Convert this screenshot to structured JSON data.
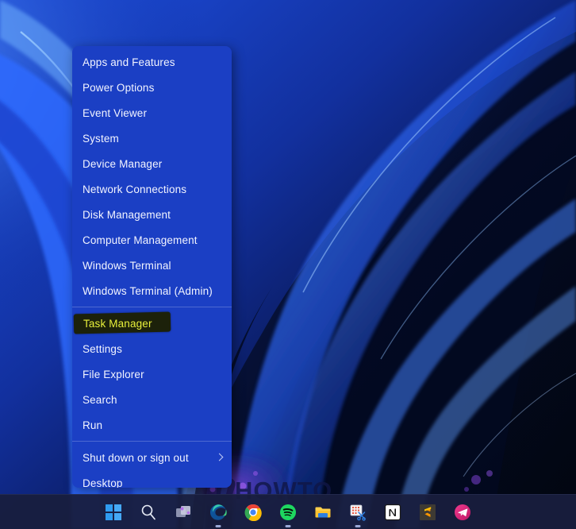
{
  "desktop": {
    "wallpaper_name": "windows-11-bloom-blue",
    "colors": {
      "bg_deep": "#09133a",
      "ribbon_bright": "#2f6cff",
      "ribbon_mid": "#1535b4",
      "ribbon_dark": "#050b26",
      "accent": "#3a7bff"
    }
  },
  "watermark": {
    "text": "HOWTO",
    "color": "#101646"
  },
  "winx_menu": {
    "name": "Windows X / Quick Link menu",
    "background": "#1b3fc4",
    "items": [
      {
        "label": "Apps and Features",
        "type": "item",
        "chevron": false
      },
      {
        "label": "Power Options",
        "type": "item",
        "chevron": false
      },
      {
        "label": "Event Viewer",
        "type": "item",
        "chevron": false
      },
      {
        "label": "System",
        "type": "item",
        "chevron": false
      },
      {
        "label": "Device Manager",
        "type": "item",
        "chevron": false
      },
      {
        "label": "Network Connections",
        "type": "item",
        "chevron": false
      },
      {
        "label": "Disk Management",
        "type": "item",
        "chevron": false
      },
      {
        "label": "Computer Management",
        "type": "item",
        "chevron": false
      },
      {
        "label": "Windows Terminal",
        "type": "item",
        "chevron": false
      },
      {
        "label": "Windows Terminal (Admin)",
        "type": "item",
        "chevron": false
      },
      {
        "type": "separator"
      },
      {
        "label": "Task Manager",
        "type": "item",
        "chevron": false,
        "highlighted": true
      },
      {
        "label": "Settings",
        "type": "item",
        "chevron": false
      },
      {
        "label": "File Explorer",
        "type": "item",
        "chevron": false
      },
      {
        "label": "Search",
        "type": "item",
        "chevron": false
      },
      {
        "label": "Run",
        "type": "item",
        "chevron": false
      },
      {
        "type": "separator"
      },
      {
        "label": "Shut down or sign out",
        "type": "item",
        "chevron": true
      },
      {
        "label": "Desktop",
        "type": "item",
        "chevron": false
      }
    ],
    "highlight": {
      "target": "Task Manager",
      "box_color": "#1c210a",
      "text_color": "#e8f03a"
    }
  },
  "taskbar": {
    "background": "#181e3e",
    "icons": [
      {
        "name": "start-icon",
        "label": "Start",
        "running": false
      },
      {
        "name": "search-icon",
        "label": "Search",
        "running": false
      },
      {
        "name": "task-view-icon",
        "label": "Task View",
        "running": false
      },
      {
        "name": "microsoft-edge-icon",
        "label": "Microsoft Edge",
        "running": true
      },
      {
        "name": "google-chrome-icon",
        "label": "Google Chrome",
        "running": false
      },
      {
        "name": "spotify-icon",
        "label": "Spotify",
        "running": true
      },
      {
        "name": "file-explorer-icon",
        "label": "File Explorer",
        "running": false
      },
      {
        "name": "snipping-tool-icon",
        "label": "Snipping Tool",
        "running": true
      },
      {
        "name": "notion-icon",
        "label": "Notion",
        "running": false
      },
      {
        "name": "sublime-text-icon",
        "label": "Sublime Text",
        "running": false
      },
      {
        "name": "telegram-icon",
        "label": "Telegram",
        "running": false
      }
    ]
  }
}
